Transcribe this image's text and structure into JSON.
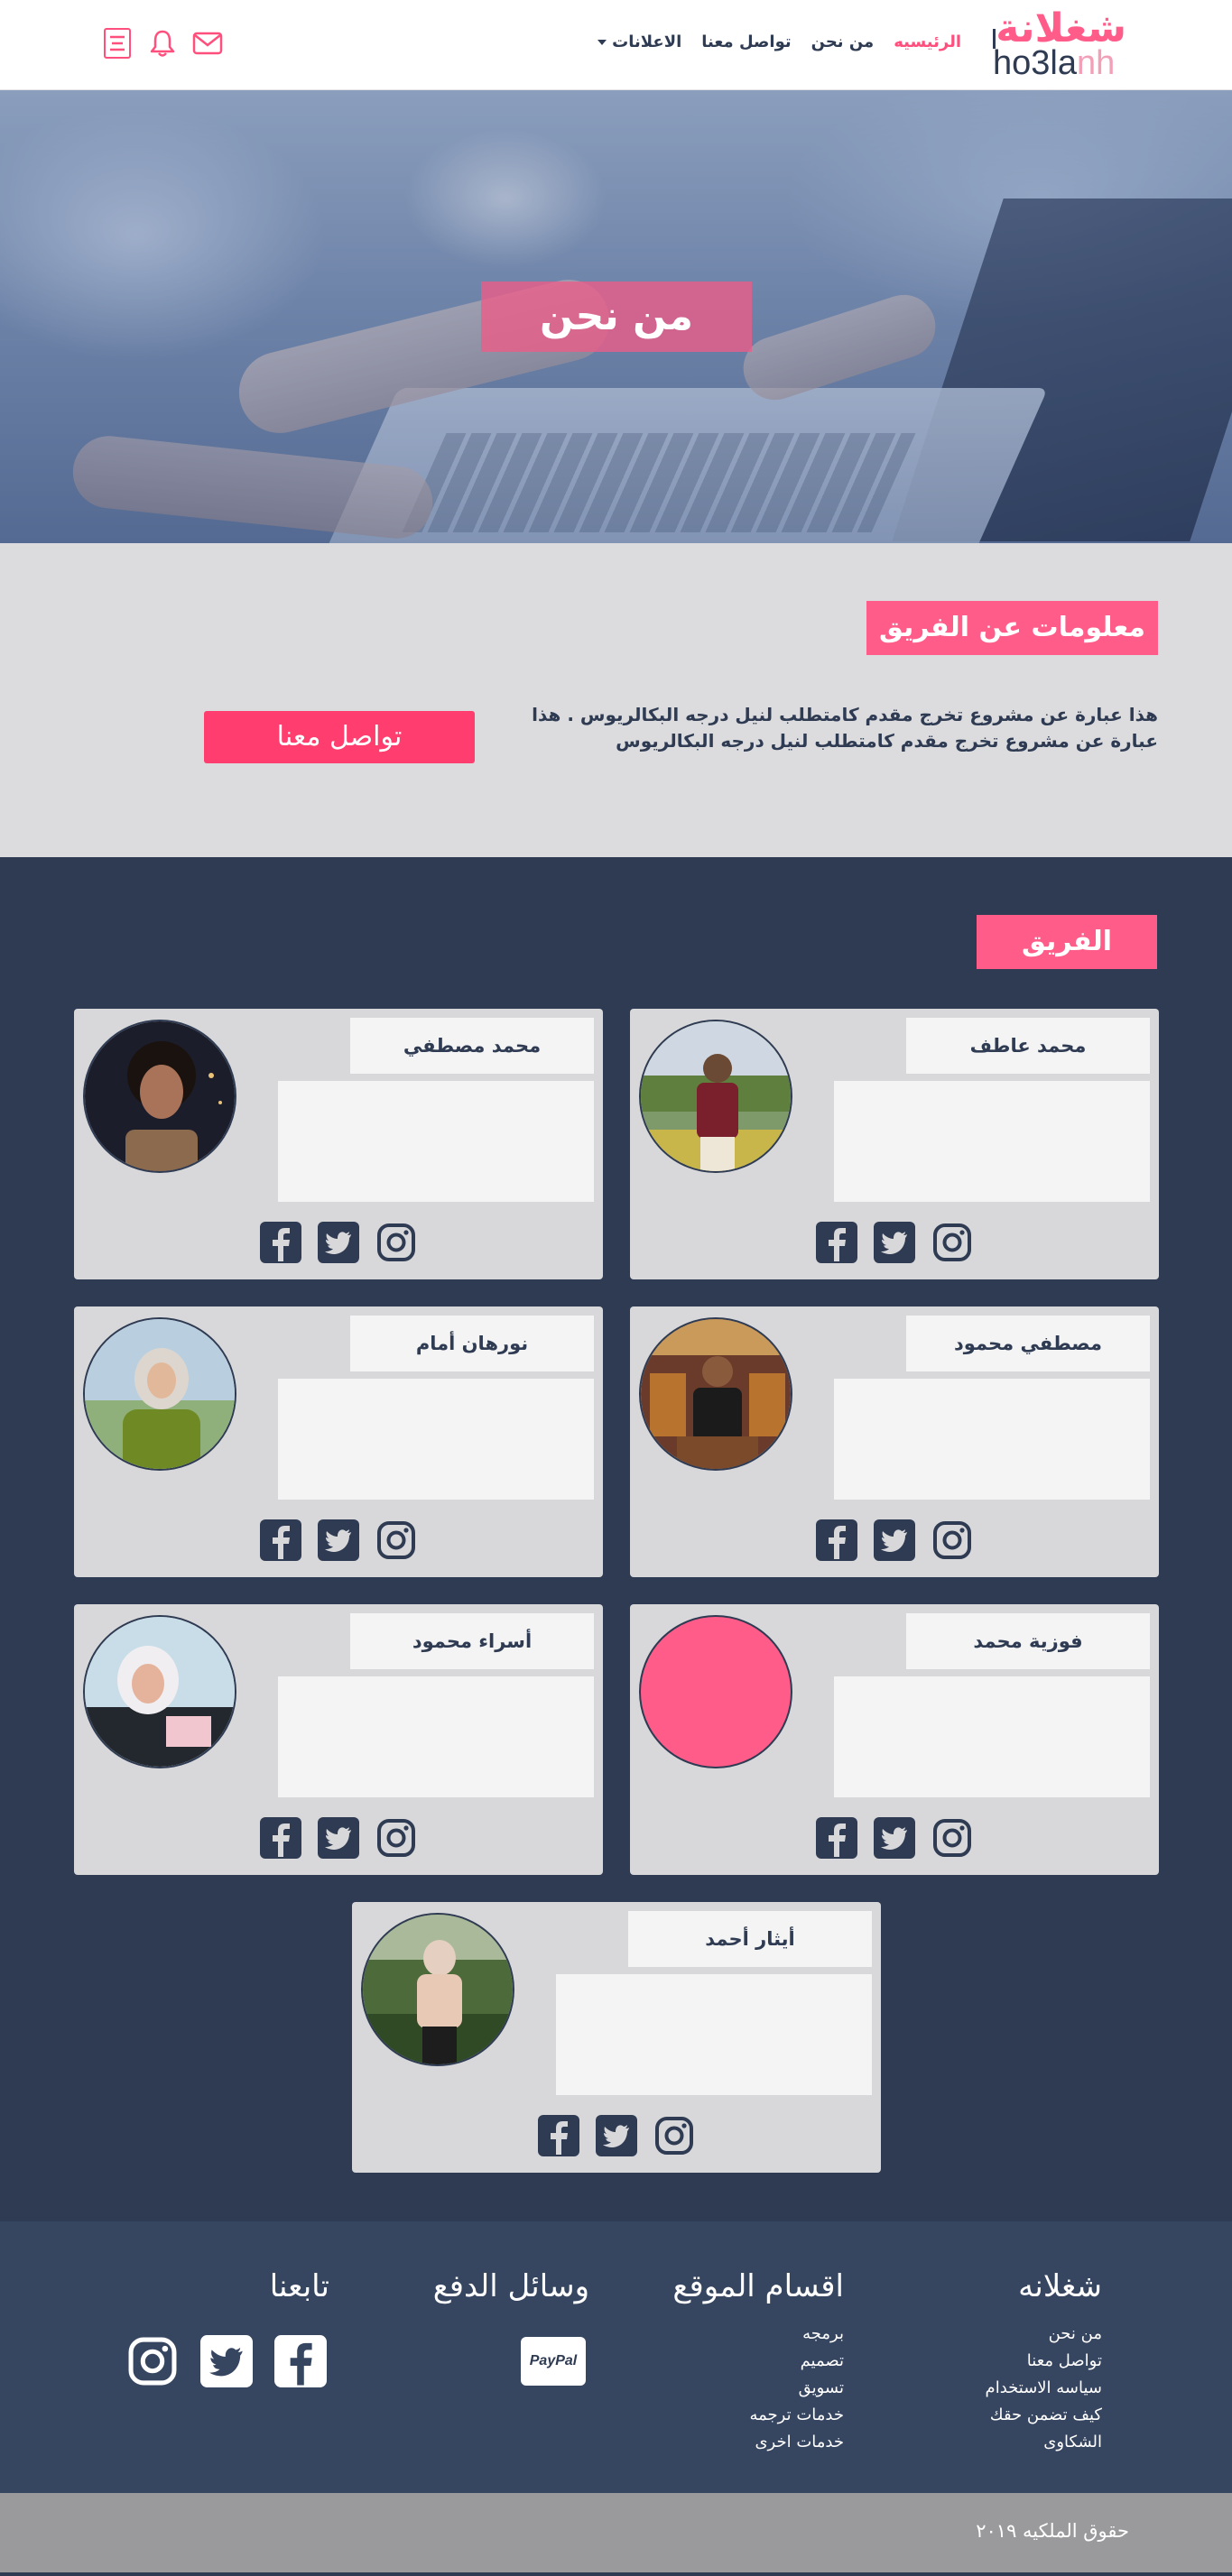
{
  "brand": {
    "logo_ar": "شغلانة",
    "logo_latin_main": "ho3la",
    "logo_latin_tail": "nh"
  },
  "nav": {
    "items": [
      {
        "label": "الرئيسيه",
        "active": true
      },
      {
        "label": "من نحن",
        "active": false
      },
      {
        "label": "تواصل معنا",
        "active": false
      },
      {
        "label": "الاعلانات",
        "active": false,
        "dropdown": true
      }
    ],
    "icons": [
      "menu-icon",
      "bell-icon",
      "mail-icon"
    ]
  },
  "hero": {
    "title": "من نحن"
  },
  "about": {
    "title": "معلومات عن الفريق",
    "text": "هذا عبارة عن مشروع تخرج  مقدم كامتطلب لنيل درجه البكالريوس . هذا عبارة عن مشروع تخرج  مقدم كامتطلب لنيل درجه البكالريوس",
    "contact_button": "تواصل معنا"
  },
  "team": {
    "title": "الفريق",
    "members": [
      {
        "name": "محمد عاطف"
      },
      {
        "name": "محمد مصطفي"
      },
      {
        "name": "مصطفي محمود"
      },
      {
        "name": "نورهان أمام"
      },
      {
        "name": "فوزية محمد"
      },
      {
        "name": "أسراء محمود"
      },
      {
        "name": "أيثار أحمد"
      }
    ]
  },
  "footer": {
    "col1": {
      "title": "شغلانه",
      "links": [
        "من نحن",
        "تواصل معنا",
        "سياسه الاستخدام",
        "كيف تضمن حقك",
        "الشكاوى"
      ]
    },
    "col2": {
      "title": "اقسام الموقع",
      "links": [
        "برمجه",
        "تصميم",
        "تسويق",
        "خدمات ترجمه",
        "خدمات اخرى"
      ]
    },
    "col3": {
      "title": "وسائل الدفع",
      "paypal": "PayPal"
    },
    "col4": {
      "title": "تابعنا"
    }
  },
  "copyright": "حقوق الملكيه ٢٠١٩",
  "colors": {
    "accent": "#ff5c8a",
    "dark": "#2e3b52",
    "footer": "#364560"
  }
}
